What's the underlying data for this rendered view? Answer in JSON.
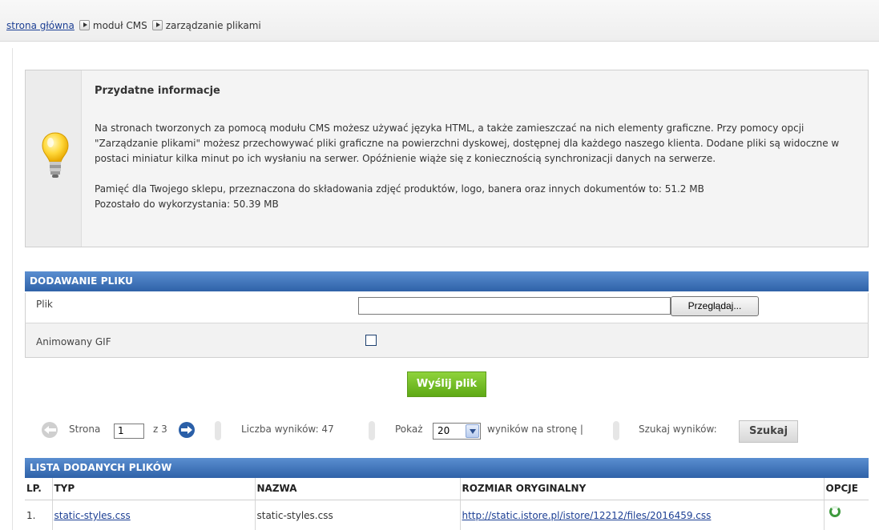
{
  "breadcrumb": {
    "home": "strona główna",
    "cms": "moduł CMS",
    "files": "zarządzanie plikami"
  },
  "info": {
    "title": "Przydatne informacje",
    "paragraph1": "Na stronach tworzonych za pomocą modułu CMS możesz używać języka HTML, a także zamieszczać na nich elementy graficzne. Przy pomocy opcji \"Zarządzanie plikami\" możesz przechowywać pliki graficzne na powierzchni dyskowej, dostępnej dla każdego naszego klienta. Dodane pliki są widoczne w postaci miniatur kilka minut po ich wysłaniu na serwer. Opóźnienie wiąże się z koniecznością synchronizacji danych na serwerze.",
    "storage": "Pamięć dla Twojego sklepu, przeznaczona do składowania zdjęć produktów, logo, banera oraz innych dokumentów to: 51.2 MB",
    "remaining": "Pozostało do wykorzystania: 50.39 MB"
  },
  "upload": {
    "header": "DODAWANIE PLIKU",
    "file_label": "Plik",
    "file_value": "",
    "browse_label": "Przeglądaj...",
    "gif_label": "Animowany GIF",
    "gif_checked": false,
    "send_label": "Wyślij plik"
  },
  "pager": {
    "page_label": "Strona",
    "page_value": "1",
    "of_label": "z 3",
    "results_label": "Liczba wyników: 47",
    "show_label": "Pokaż",
    "per_page_value": "20",
    "per_page_suffix": "wyników na stronę |",
    "search_label": "Szukaj wyników:",
    "search_button": "Szukaj"
  },
  "list": {
    "header": "LISTA DODANYCH PLIKÓW",
    "columns": [
      "LP.",
      "TYP",
      "NAZWA",
      "ROZMIAR ORYGINALNY",
      "OPCJE"
    ],
    "rows": [
      {
        "lp": "1.",
        "type": "static-styles.css",
        "name": "static-styles.css",
        "size": "http://static.istore.pl/istore/12212/files/2016459.css",
        "option_icon": "refresh-icon"
      }
    ]
  },
  "colors": {
    "header_blue": "#2f62a8",
    "send_green": "#6bb520",
    "link": "#1c3f94"
  }
}
